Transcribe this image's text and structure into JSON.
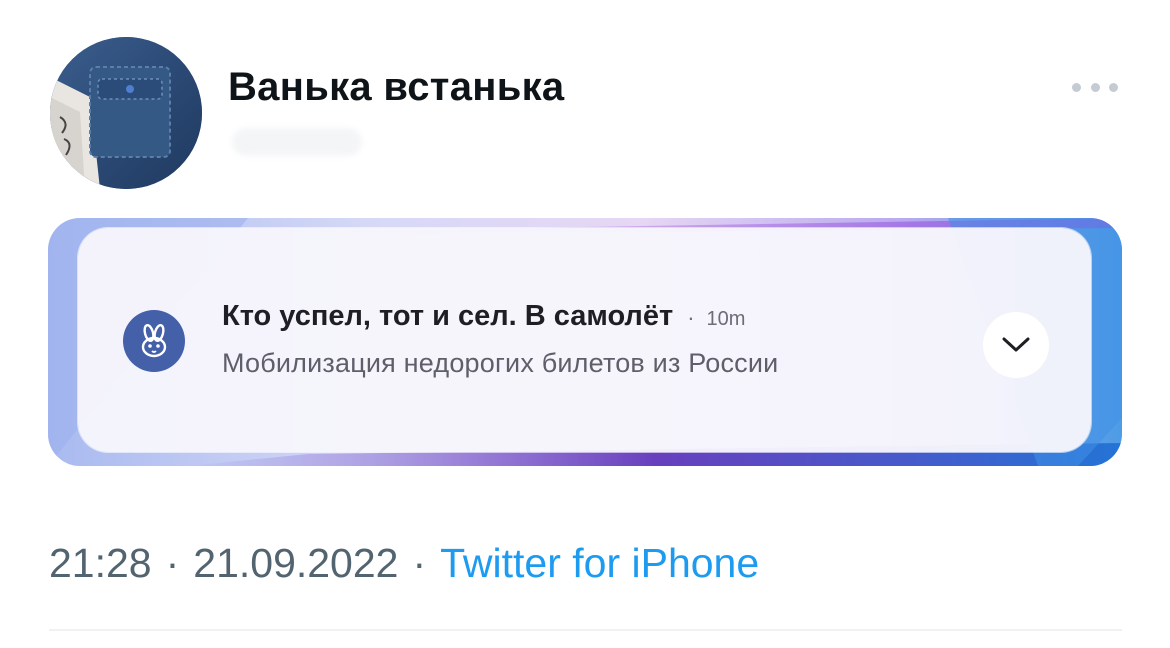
{
  "tweet": {
    "display_name": "Ванька встанька",
    "more_icon": "more-horizontal-icon"
  },
  "media": {
    "notification": {
      "app_icon": "rabbit-app-icon",
      "title": "Кто успел, тот и сел. В самолёт",
      "separator": "·",
      "time": "10m",
      "body": "Мобилизация недорогих билетов из России",
      "expand_icon": "chevron-down-icon"
    }
  },
  "meta": {
    "time": "21:28",
    "separator": "·",
    "date": "21.09.2022",
    "source": "Twitter for iPhone"
  },
  "colors": {
    "link": "#1d9bf0",
    "meta_text": "#536471",
    "app_icon_bg": "#4460a9"
  }
}
